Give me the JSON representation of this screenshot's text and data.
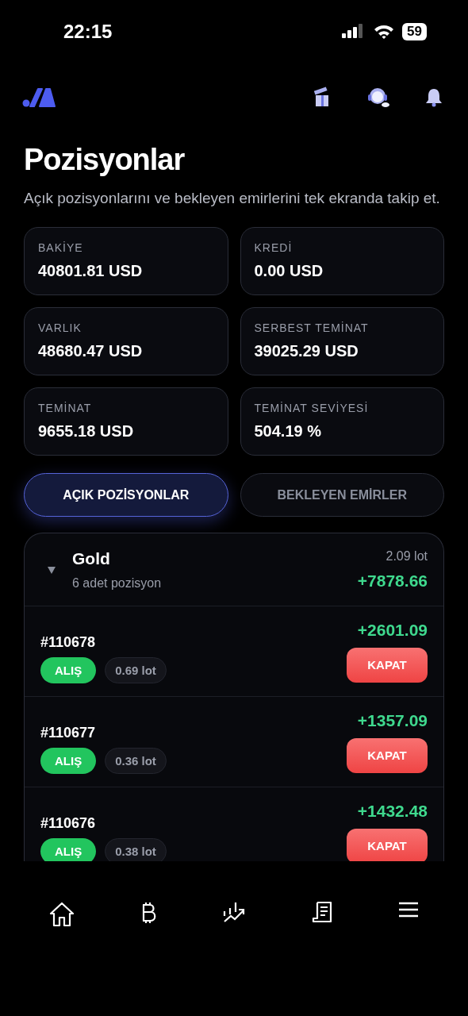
{
  "status_bar": {
    "time": "22:15",
    "battery": "59"
  },
  "page": {
    "title": "Pozisyonlar",
    "subtitle": "Açık pozisyonlarını ve bekleyen emirlerini tek ekranda takip et."
  },
  "stats": [
    {
      "label": "BAKİYE",
      "value": "40801.81 USD"
    },
    {
      "label": "KREDİ",
      "value": "0.00 USD"
    },
    {
      "label": "VARLIK",
      "value": "48680.47 USD"
    },
    {
      "label": "SERBEST TEMİNAT",
      "value": "39025.29 USD"
    },
    {
      "label": "TEMİNAT",
      "value": "9655.18 USD"
    },
    {
      "label": "TEMİNAT SEVİYESİ",
      "value": "504.19 %"
    }
  ],
  "tabs": [
    {
      "label": "AÇIK POZİSYONLAR",
      "selected": true
    },
    {
      "label": "BEKLEYEN EMİRLER",
      "selected": false
    }
  ],
  "group": {
    "name": "Gold",
    "count": "6 adet pozisyon",
    "lots": "2.09 lot",
    "profit": "+7878.66",
    "expanded": true
  },
  "positions": [
    {
      "id": "#110678",
      "side": "ALIŞ",
      "lots": "0.69 lot",
      "profit": "+2601.09",
      "action": "KAPAT"
    },
    {
      "id": "#110677",
      "side": "ALIŞ",
      "lots": "0.36 lot",
      "profit": "+1357.09",
      "action": "KAPAT"
    },
    {
      "id": "#110676",
      "side": "ALIŞ",
      "lots": "0.38 lot",
      "profit": "+1432.48",
      "action": "KAPAT"
    }
  ]
}
